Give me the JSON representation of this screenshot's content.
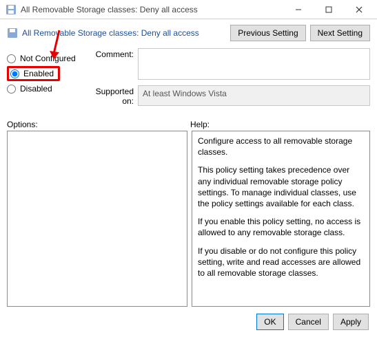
{
  "window": {
    "title": "All Removable Storage classes: Deny all access"
  },
  "header": {
    "policy_title": "All Removable Storage classes: Deny all access",
    "prev_label": "Previous Setting",
    "next_label": "Next Setting"
  },
  "state": {
    "not_configured_label": "Not Configured",
    "enabled_label": "Enabled",
    "disabled_label": "Disabled",
    "selected": "enabled"
  },
  "form": {
    "comment_label": "Comment:",
    "comment_value": "",
    "supported_label": "Supported on:",
    "supported_value": "At least Windows Vista"
  },
  "panes": {
    "options_label": "Options:",
    "help_label": "Help:",
    "help_paragraphs": [
      "Configure access to all removable storage classes.",
      "This policy setting takes precedence over any individual removable storage policy settings. To manage individual classes, use the policy settings available for each class.",
      "If you enable this policy setting, no access is allowed to any removable storage class.",
      "If you disable or do not configure this policy setting, write and read accesses are allowed to all removable storage classes."
    ]
  },
  "footer": {
    "ok_label": "OK",
    "cancel_label": "Cancel",
    "apply_label": "Apply"
  }
}
